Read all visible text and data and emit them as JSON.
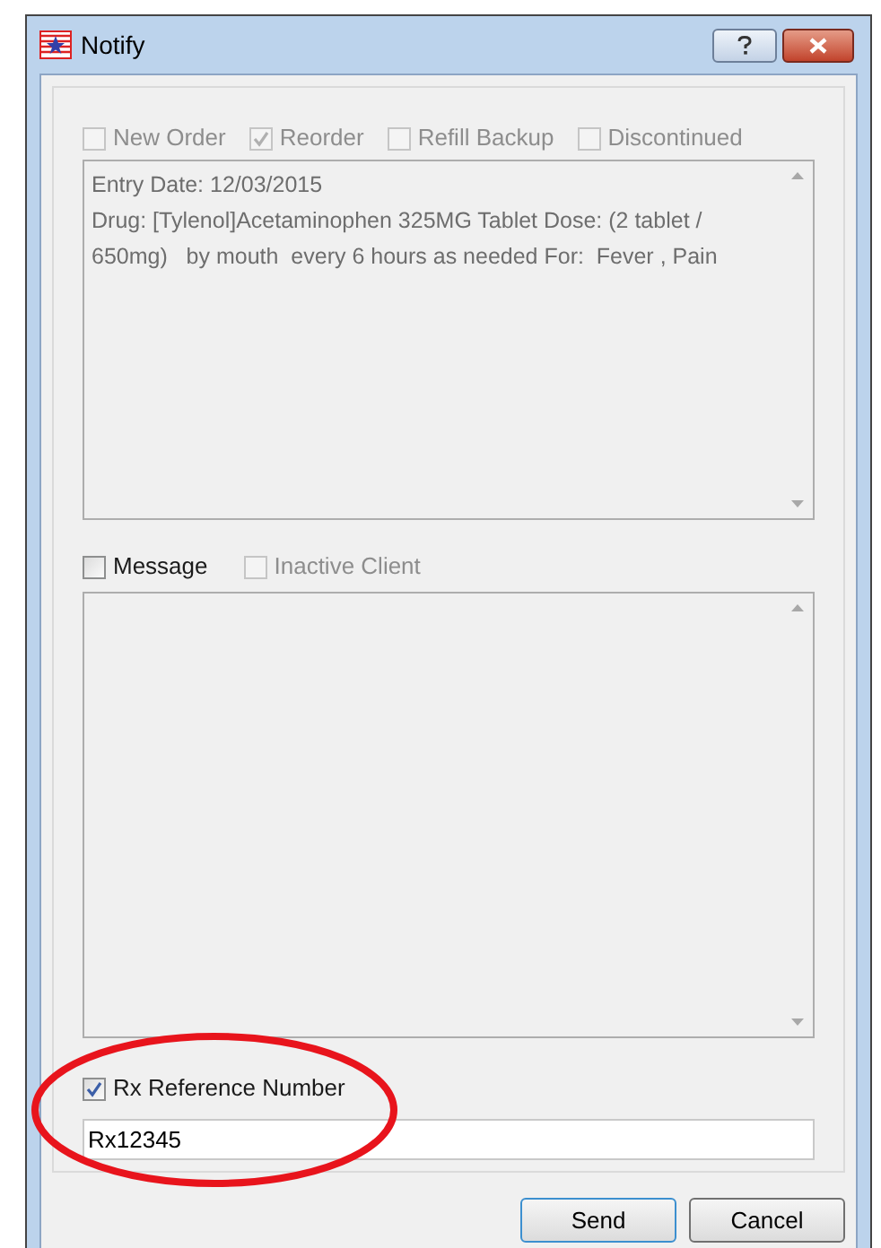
{
  "window": {
    "title": "Notify"
  },
  "order_options": [
    {
      "label": "New Order",
      "checked": false,
      "disabled": true
    },
    {
      "label": "Reorder",
      "checked": true,
      "disabled": true
    },
    {
      "label": "Refill Backup",
      "checked": false,
      "disabled": true
    },
    {
      "label": "Discontinued",
      "checked": false,
      "disabled": true
    }
  ],
  "order_details": {
    "lines": [
      "Entry Date: 12/03/2015",
      "Drug: [Tylenol]Acetaminophen 325MG Tablet Dose: (2 tablet / 650mg)   by mouth  every 6 hours as needed For:  Fever , Pain"
    ]
  },
  "message_options": [
    {
      "label": "Message",
      "checked": false,
      "disabled": false
    },
    {
      "label": "Inactive Client",
      "checked": false,
      "disabled": true
    }
  ],
  "rx_reference": {
    "label": "Rx Reference Number",
    "checked": true,
    "disabled": false,
    "value": "Rx12345"
  },
  "buttons": [
    {
      "label": "Send",
      "default": true
    },
    {
      "label": "Cancel",
      "default": false
    }
  ],
  "annotation": {
    "kind": "ellipse",
    "color": "#e8141c"
  }
}
